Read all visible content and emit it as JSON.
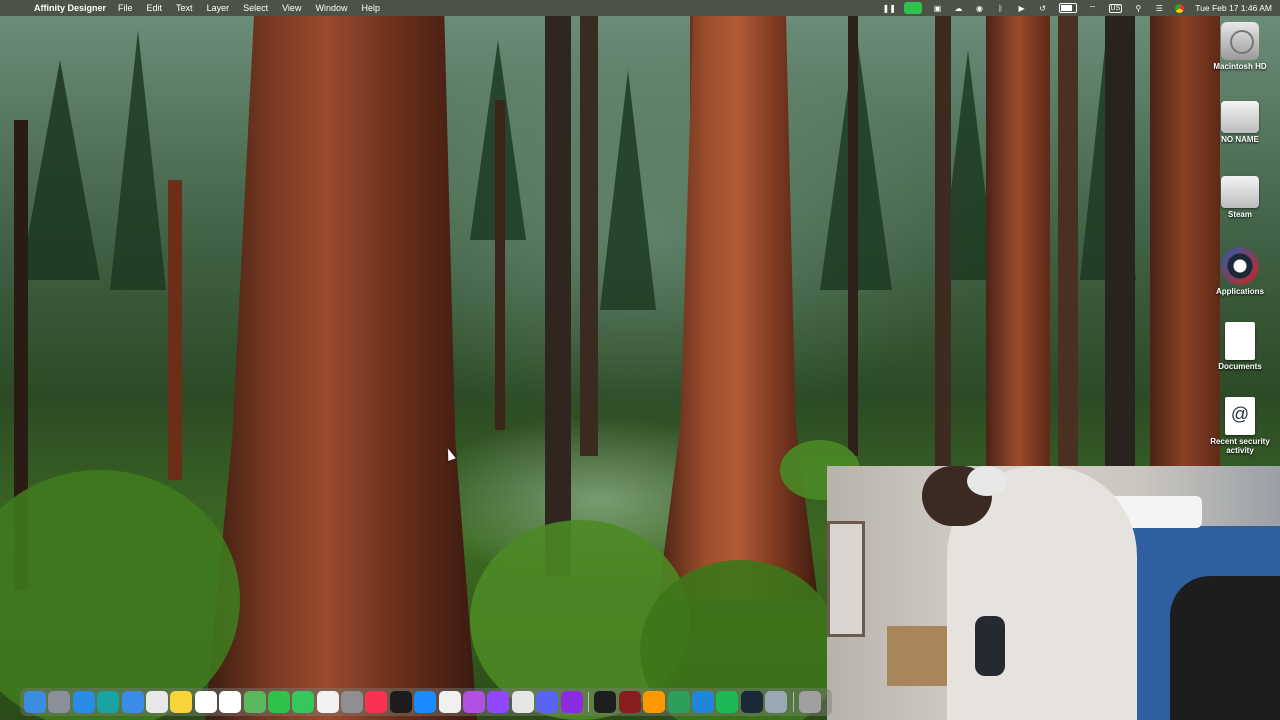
{
  "menubar": {
    "apple_glyph": "",
    "app_name": "Affinity Designer",
    "menus": [
      "File",
      "Edit",
      "Text",
      "Layer",
      "Select",
      "View",
      "Window",
      "Help"
    ],
    "keyboard_layout": "US",
    "clock": "Tue Feb 17  1:46 AM",
    "status_icons": [
      "pause-icon",
      "facetime-icon",
      "screen-icon",
      "cloud-icon",
      "vpn-icon",
      "bluetooth-icon",
      "play-icon",
      "history-icon",
      "battery-icon",
      "wifi-icon",
      "keyboard-layout-icon",
      "search-icon",
      "control-center-icon",
      "chrome-icon"
    ]
  },
  "desktop": {
    "icons": [
      {
        "label": "Macintosh HD",
        "icon": "hard-drive-icon"
      },
      {
        "label": "NO NAME",
        "icon": "external-disk-icon"
      },
      {
        "label": "Steam",
        "icon": "external-disk-icon"
      },
      {
        "label": "Applications",
        "icon": "steam-icon"
      },
      {
        "label": "Documents",
        "icon": "document-icon"
      },
      {
        "label": "Recent security activity",
        "icon": "http-link-icon"
      }
    ]
  },
  "dock": {
    "apps": [
      {
        "name": "Finder",
        "icon": "finder-icon",
        "color": "#3b8de0"
      },
      {
        "name": "Launchpad",
        "icon": "launchpad-icon",
        "color": "#8a8f99"
      },
      {
        "name": "Safari",
        "icon": "safari-icon",
        "color": "#2a8be8"
      },
      {
        "name": "Proxyman",
        "icon": "proxy-icon",
        "color": "#1aa3a3"
      },
      {
        "name": "Mail",
        "icon": "mail-icon",
        "color": "#3a8ce8"
      },
      {
        "name": "Chrome",
        "icon": "chrome-icon",
        "color": "#e8e8e8"
      },
      {
        "name": "Notes",
        "icon": "notes-icon",
        "color": "#f6d43a"
      },
      {
        "name": "Calendar",
        "icon": "calendar-icon",
        "color": "#ffffff"
      },
      {
        "name": "Reminders",
        "icon": "reminders-icon",
        "color": "#ffffff"
      },
      {
        "name": "Maps",
        "icon": "maps-icon",
        "color": "#5cb85c"
      },
      {
        "name": "FaceTime",
        "icon": "facetime-icon",
        "color": "#2fc24a"
      },
      {
        "name": "Messages",
        "icon": "messages-icon",
        "color": "#35c759"
      },
      {
        "name": "News",
        "icon": "news-icon",
        "color": "#f2f2f2"
      },
      {
        "name": "System Settings",
        "icon": "settings-icon",
        "color": "#8e8e93"
      },
      {
        "name": "Music",
        "icon": "music-icon",
        "color": "#fa3150"
      },
      {
        "name": "TV",
        "icon": "tv-icon",
        "color": "#1c1c1e"
      },
      {
        "name": "App Store",
        "icon": "app-store-icon",
        "color": "#1a8cff"
      },
      {
        "name": "Photos",
        "icon": "photos-icon",
        "color": "#f0f0f0"
      },
      {
        "name": "Podcasts",
        "icon": "podcasts-icon",
        "color": "#b150e2"
      },
      {
        "name": "Twitch",
        "icon": "twitch-icon",
        "color": "#9146ff"
      },
      {
        "name": "Claquette",
        "icon": "clapperboard-icon",
        "color": "#e6e6e6"
      },
      {
        "name": "Discord",
        "icon": "discord-icon",
        "color": "#5865f2"
      },
      {
        "name": "Affinity Designer",
        "icon": "affinity-icon",
        "color": "#8a2be2"
      },
      {
        "name": "Terminal",
        "icon": "terminal-icon",
        "color": "#1e1e1e"
      },
      {
        "name": "Game",
        "icon": "game-icon",
        "color": "#8a1e1e"
      },
      {
        "name": "Sublime Text",
        "icon": "sublime-icon",
        "color": "#ff9800"
      },
      {
        "name": "Git Tool",
        "icon": "git-icon",
        "color": "#2e9e5b"
      },
      {
        "name": "VS Code",
        "icon": "vscode-icon",
        "color": "#1f86d9"
      },
      {
        "name": "Spotify",
        "icon": "spotify-icon",
        "color": "#1db954"
      },
      {
        "name": "Steam",
        "icon": "steam-icon",
        "color": "#1b2838"
      },
      {
        "name": "Preview",
        "icon": "preview-icon",
        "color": "#9aa7b5"
      },
      {
        "name": "Trash",
        "icon": "trash-icon",
        "color": "#a0a0a0"
      }
    ]
  }
}
